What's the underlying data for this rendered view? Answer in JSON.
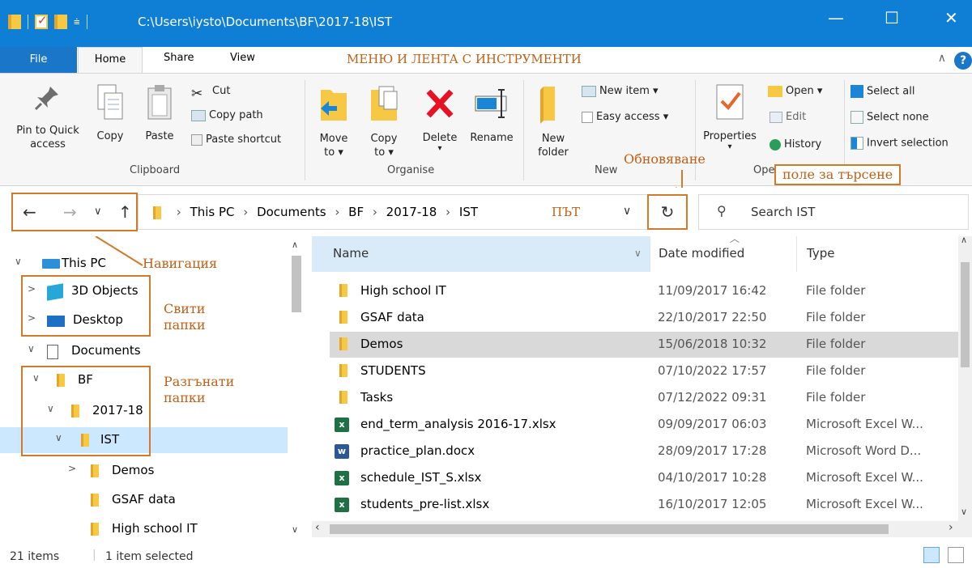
{
  "window": {
    "title": "C:\\Users\\iysto\\Documents\\BF\\2017-18\\IST",
    "minimize": "—",
    "maximize": "☐",
    "close": "✕"
  },
  "tabs": [
    "File",
    "Home",
    "Share",
    "View"
  ],
  "ribbon_note": "МЕНЮ И ЛЕНТА С ИНСТРУМЕНТИ",
  "ribbon": {
    "clipboard": {
      "label": "Clipboard",
      "pin": "Pin to Quick access",
      "copy": "Copy",
      "paste": "Paste",
      "cut": "Cut",
      "copy_path": "Copy path",
      "paste_shortcut": "Paste shortcut"
    },
    "organise": {
      "label": "Organise",
      "move_to": "Move to ▾",
      "copy_to": "Copy to ▾",
      "delete": "Delete",
      "rename": "Rename"
    },
    "new": {
      "label": "New",
      "new_folder": "New folder",
      "new_item": "New item ▾",
      "easy_access": "Easy access ▾"
    },
    "open": {
      "label": "Ope",
      "properties": "Properties",
      "open": "Open ▾",
      "edit": "Edit",
      "history": "History"
    },
    "select": {
      "select_all": "Select all",
      "select_none": "Select none",
      "invert": "Invert selection"
    }
  },
  "annotations": {
    "refresh": "Обновяване",
    "search": "поле за търсене",
    "path": "ПЪТ",
    "navigation": "Навигация",
    "collapsed": "Свити\nпапки",
    "expanded": "Разгънати\nпапки"
  },
  "address": {
    "crumbs": [
      "This PC",
      "Documents",
      "BF",
      "2017-18",
      "IST"
    ],
    "search_placeholder": "Search IST"
  },
  "tree": [
    {
      "label": "This PC",
      "arrow": "∨"
    },
    {
      "label": "3D Objects",
      "arrow": ">"
    },
    {
      "label": "Desktop",
      "arrow": ">"
    },
    {
      "label": "Documents",
      "arrow": "∨"
    },
    {
      "label": "BF",
      "arrow": "∨"
    },
    {
      "label": "2017-18",
      "arrow": "∨"
    },
    {
      "label": "IST",
      "arrow": "∨"
    },
    {
      "label": "Demos",
      "arrow": ">"
    },
    {
      "label": "GSAF data",
      "arrow": ""
    },
    {
      "label": "High school IT",
      "arrow": ""
    }
  ],
  "columns": {
    "name": "Name",
    "date": "Date modified",
    "type": "Type"
  },
  "files": [
    {
      "name": "High school IT",
      "date": "11/09/2017 16:42",
      "type": "File folder",
      "kind": "folder"
    },
    {
      "name": "GSAF data",
      "date": "22/10/2017 22:50",
      "type": "File folder",
      "kind": "folder"
    },
    {
      "name": "Demos",
      "date": "15/06/2018 10:32",
      "type": "File folder",
      "kind": "folder"
    },
    {
      "name": "STUDENTS",
      "date": "07/10/2022 17:57",
      "type": "File folder",
      "kind": "folder"
    },
    {
      "name": "Tasks",
      "date": "07/12/2022 09:31",
      "type": "File folder",
      "kind": "folder"
    },
    {
      "name": "end_term_analysis 2016-17.xlsx",
      "date": "09/09/2017 06:03",
      "type": "Microsoft Excel W...",
      "kind": "excel"
    },
    {
      "name": "practice_plan.docx",
      "date": "28/09/2017 17:28",
      "type": "Microsoft Word D...",
      "kind": "word"
    },
    {
      "name": "schedule_IST_S.xlsx",
      "date": "04/10/2017 10:28",
      "type": "Microsoft Excel W...",
      "kind": "excel"
    },
    {
      "name": "students_pre-list.xlsx",
      "date": "16/10/2017 12:05",
      "type": "Microsoft Excel W...",
      "kind": "excel"
    }
  ],
  "status": {
    "items": "21 items",
    "selected": "1 item selected"
  }
}
